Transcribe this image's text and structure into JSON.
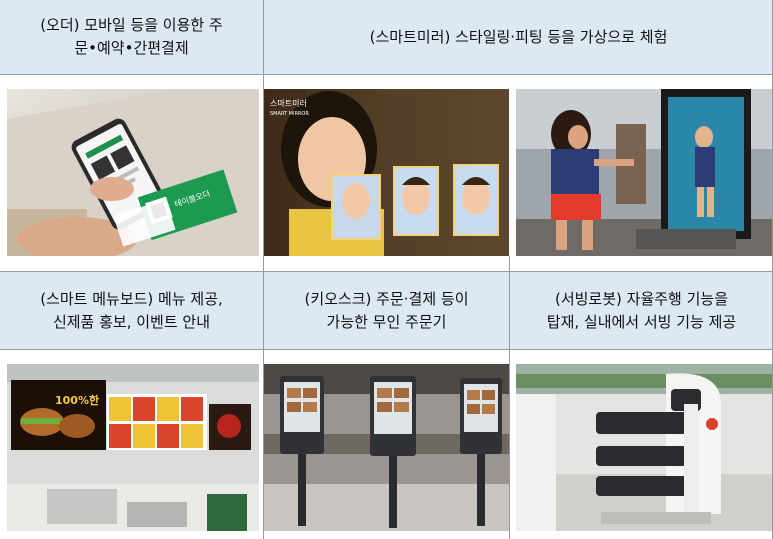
{
  "rows": [
    {
      "headers": [
        {
          "text": "(오더) 모바일 등을 이용한 주\n문•예약•간편결제",
          "span": 1
        },
        {
          "text": "(스마트미러) 스타일링·피팅 등을 가상으로 체험",
          "span": 2
        }
      ],
      "photos": [
        "mobile-order-photo",
        "smart-mirror-face-photo",
        "smart-mirror-fitting-photo"
      ]
    },
    {
      "headers": [
        {
          "text": "(스마트 메뉴보드) 메뉴 제공,\n신제품 홍보, 이벤트 안내",
          "span": 1
        },
        {
          "text": "(키오스크) 주문·결제 등이\n가능한 무인 주문기",
          "span": 1
        },
        {
          "text": "(서빙로봇) 자율주행 기능을\n탑재, 실내에서 서빙 기능 제공",
          "span": 1
        }
      ],
      "photos": [
        "smart-menuboard-photo",
        "kiosk-photo",
        "serving-robot-photo"
      ]
    }
  ],
  "photo_text": {
    "mirror_brand": "스마트미러",
    "mirror_brand_sub": "SMART MIRROR",
    "qr_card_label": "테이블오더",
    "menu_board_text": "100%한"
  }
}
